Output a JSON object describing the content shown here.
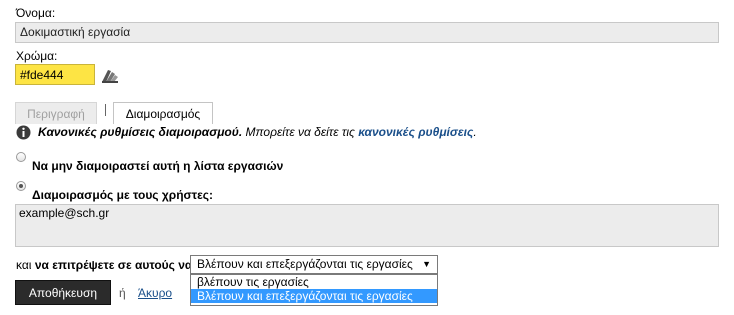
{
  "form": {
    "name_label": "Όνομα:",
    "name_value": "Δοκιμαστική εργασία",
    "color_label": "Χρώμα:",
    "color_value": "#fde444",
    "color_picker_icon": "palette-icon"
  },
  "tabs": [
    {
      "label": "Περιγραφή",
      "active": false
    },
    {
      "label": "Διαμοιρασμός",
      "active": true
    }
  ],
  "sharing": {
    "info_icon": "info-icon",
    "info_bold": "Κανονικές ρυθμίσεις διαμοιρασμού.",
    "info_text": "Μπορείτε να δείτε τις",
    "info_link": "κανονικές ρυθμίσεις",
    "info_end": ".",
    "option_no_share": "Να μην διαμοιραστεί αυτή η λίστα εργασιών",
    "option_share_users": "Διαμοιρασμός με τους χρήστες:",
    "users_value": "example@sch.gr",
    "permission_prefix_normal": "και",
    "permission_prefix_bold": "να επιτρέψετε σε αυτούς να",
    "permission_selected": "Βλέπουν και επεξεργάζονται τις εργασίες",
    "permission_options": [
      "βλέπουν τις εργασίες",
      "Βλέπουν και επεξεργάζονται τις εργασίες"
    ]
  },
  "actions": {
    "save_label": "Αποθήκευση",
    "or_label": "ή",
    "cancel_label": "Άκυρο"
  },
  "colors": {
    "accent": "#fde444",
    "selection": "#3399ff",
    "button": "#2b2b2b"
  }
}
